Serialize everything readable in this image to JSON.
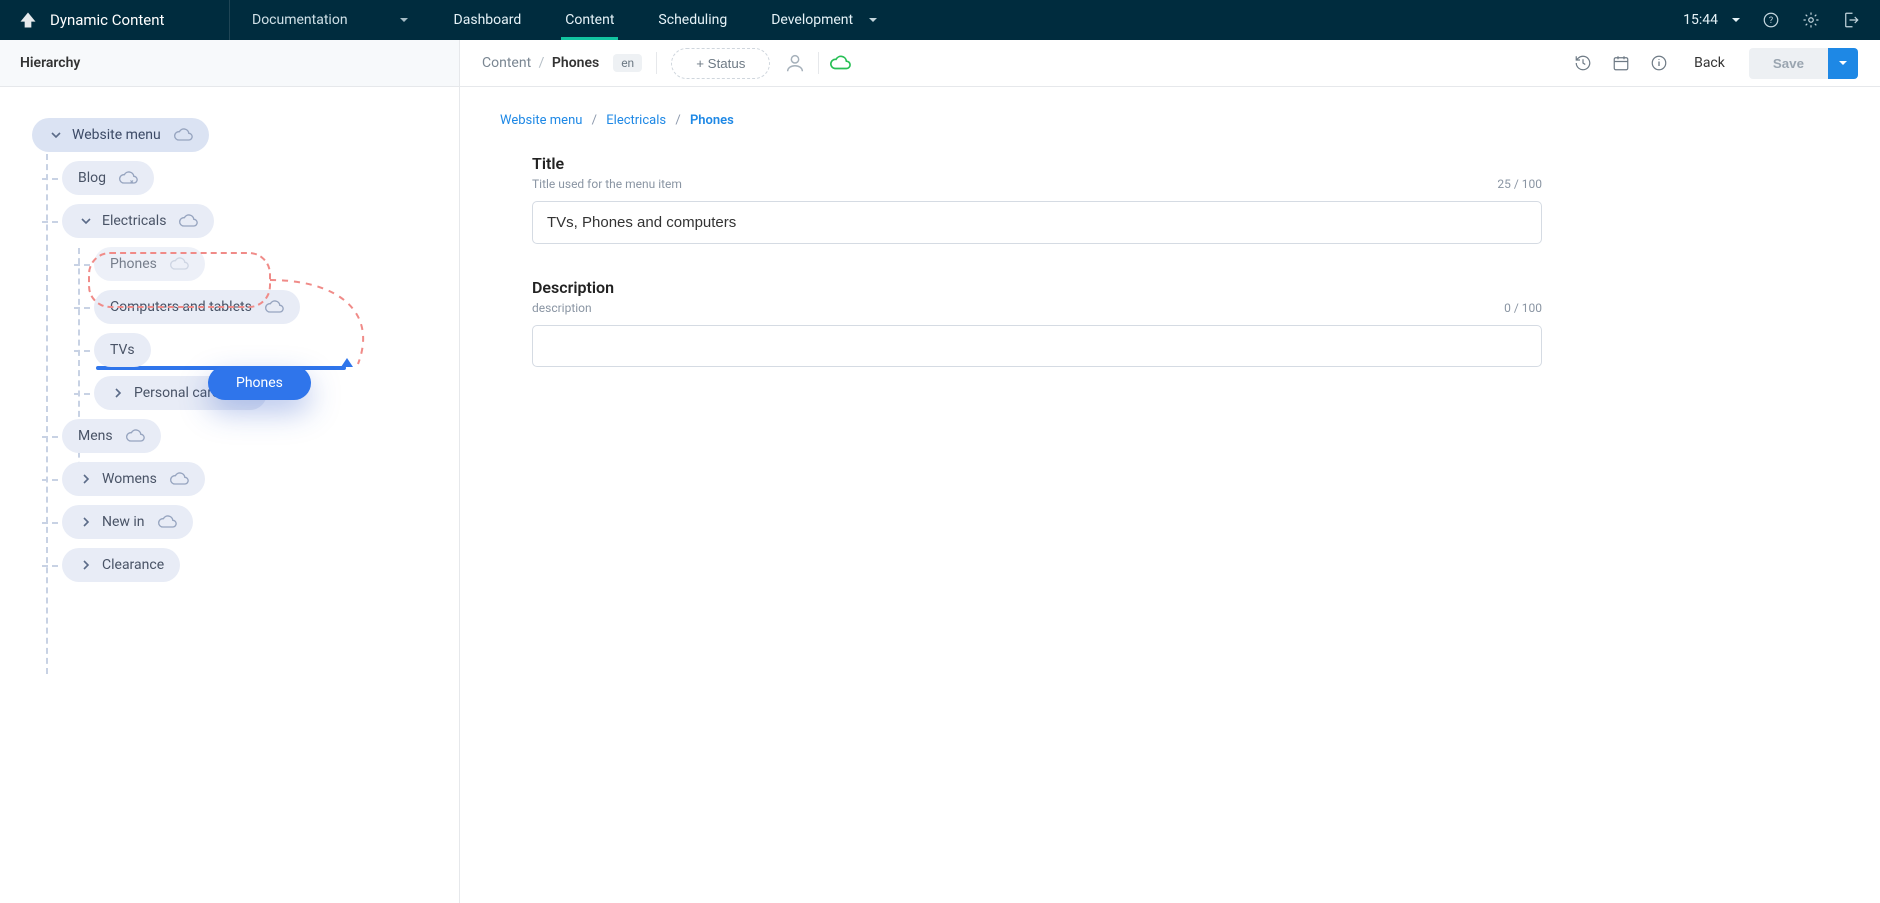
{
  "brand": {
    "name": "Dynamic Content"
  },
  "hub": {
    "label": "Documentation"
  },
  "nav": [
    {
      "label": "Dashboard",
      "active": false,
      "hasCaret": false
    },
    {
      "label": "Content",
      "active": true,
      "hasCaret": false
    },
    {
      "label": "Scheduling",
      "active": false,
      "hasCaret": false
    },
    {
      "label": "Development",
      "active": false,
      "hasCaret": true
    }
  ],
  "time": "15:44",
  "hierarchy": {
    "panelTitleIcon": "hierarchy-icon",
    "panelTitle": "Hierarchy",
    "root": "Website menu",
    "l1": [
      {
        "key": "blog",
        "label": "Blog",
        "cloudOff": true
      },
      {
        "key": "electricals",
        "label": "Electricals",
        "expandable": true,
        "expanded": true,
        "children": [
          {
            "key": "phones",
            "label": "Phones",
            "dim": true
          },
          {
            "key": "computers",
            "label": "Computers and tablets"
          },
          {
            "key": "tvs",
            "label": "TVs"
          },
          {
            "key": "personal",
            "label": "Personal care",
            "expandable": true
          }
        ]
      },
      {
        "key": "mens",
        "label": "Mens"
      },
      {
        "key": "womens",
        "label": "Womens",
        "expandable": true
      },
      {
        "key": "newin",
        "label": "New in",
        "expandable": true
      },
      {
        "key": "clearance",
        "label": "Clearance",
        "expandable": true
      }
    ],
    "dragGhost": "Phones"
  },
  "breadcrumb": {
    "root": "Content",
    "current": "Phones",
    "lang": "en"
  },
  "statusLabel": "+ Status",
  "backLabel": "Back",
  "saveLabel": "Save",
  "contentCrumbs": [
    "Website menu",
    "Electricals",
    "Phones"
  ],
  "form": {
    "title": {
      "label": "Title",
      "help": "Title used for the menu item",
      "value": "TVs, Phones and computers",
      "count": "25 / 100"
    },
    "description": {
      "label": "Description",
      "help": "description",
      "value": "",
      "count": "0 / 100"
    }
  }
}
